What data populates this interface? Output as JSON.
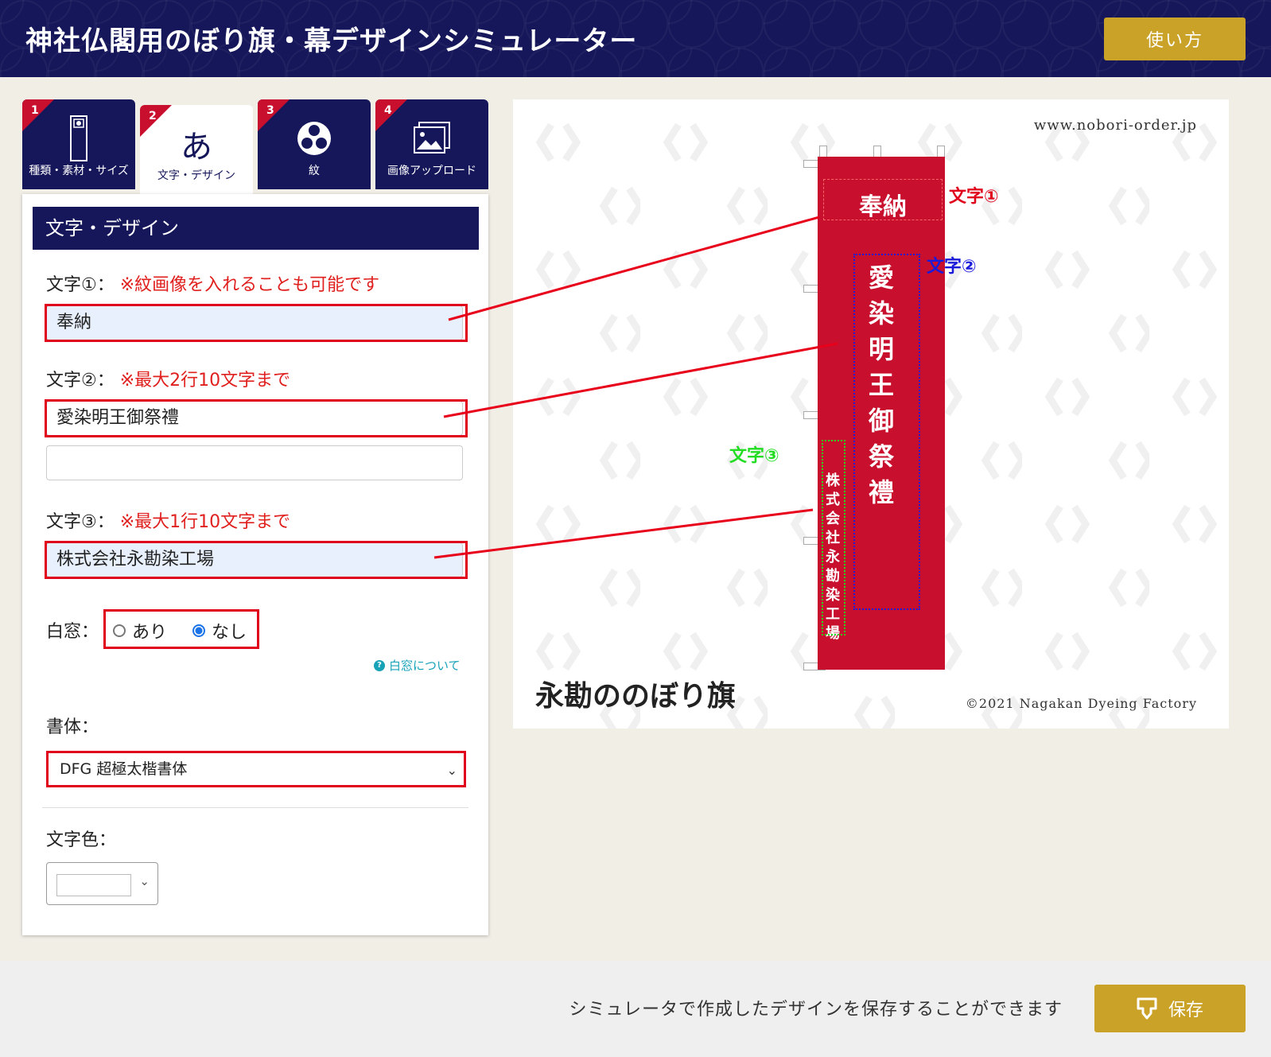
{
  "header": {
    "title": "神社仏閣用のぼり旗・幕デザインシミュレーター",
    "howto_label": "使い方"
  },
  "tabs": [
    {
      "num": "1",
      "label": "種類・素材・サイズ",
      "icon": "banner-icon",
      "active": false
    },
    {
      "num": "2",
      "label": "文字・デザイン",
      "icon": "a",
      "icon_char": "あ",
      "active": true
    },
    {
      "num": "3",
      "label": "紋",
      "icon": "tomoe-icon",
      "active": false
    },
    {
      "num": "4",
      "label": "画像アップロード",
      "icon": "image-icon",
      "active": false
    }
  ],
  "panel": {
    "title": "文字・デザイン",
    "text1": {
      "label": "文字①：",
      "note": "※紋画像を入れることも可能です",
      "value": "奉納"
    },
    "text2": {
      "label": "文字②：",
      "note": "※最大2行10文字まで",
      "value": "愛染明王御祭禮",
      "value2": ""
    },
    "text3": {
      "label": "文字③：",
      "note": "※最大1行10文字まで",
      "value": "株式会社永勘染工場"
    },
    "window": {
      "label": "白窓：",
      "opt_yes": "あり",
      "opt_no": "なし",
      "selected": "なし",
      "help": "白窓について"
    },
    "font": {
      "label": "書体：",
      "selected": "DFG 超極太楷書体"
    },
    "color": {
      "label": "文字色："
    }
  },
  "preview": {
    "url": "www.nobori-order.jp",
    "copyright": "©2021 Nagakan Dyeing Factory",
    "logo": "永勘ののぼり旗",
    "flag_color": "#c8102e",
    "flag_text1": "奉納",
    "flag_text2": "愛染明王御祭禮",
    "flag_text3": "株式会社永勘染工場",
    "callout1": "文字①",
    "callout2": "文字②",
    "callout3": "文字③"
  },
  "footer": {
    "text": "シミュレータで作成したデザインを保存することができます",
    "save_label": "保存"
  },
  "colors": {
    "navy": "#16175a",
    "gold": "#c9a227",
    "red": "#e0001b",
    "callout1": "#e0001b",
    "callout2": "#1a1adb",
    "callout3": "#22dd22"
  }
}
